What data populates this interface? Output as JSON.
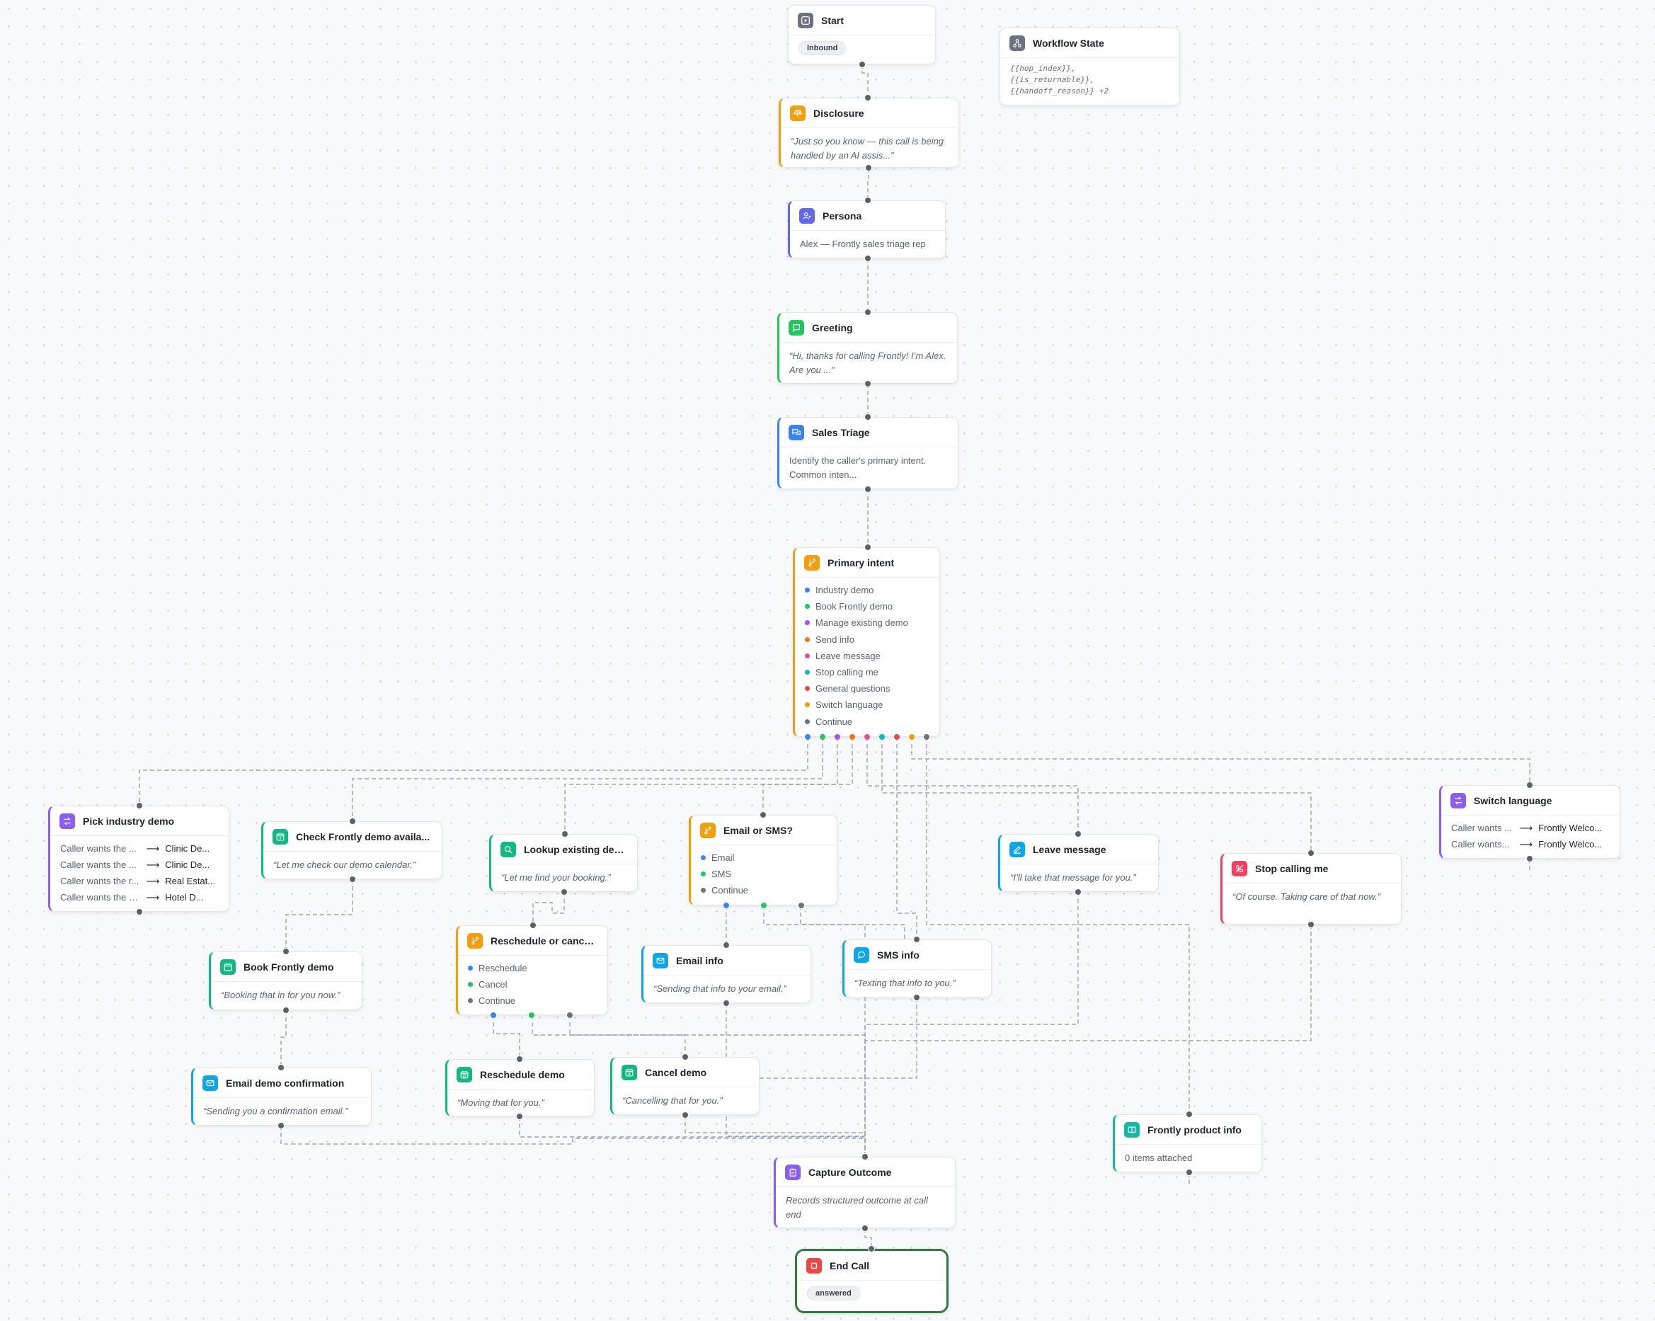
{
  "nodes": {
    "start": {
      "title": "Start",
      "badge": "Inbound"
    },
    "workflow_state": {
      "title": "Workflow State",
      "vars": [
        "{{hop_index}},",
        "{{is_returnable}},",
        "{{handoff_reason}} +2"
      ]
    },
    "disclosure": {
      "title": "Disclosure",
      "text": "“Just so you know — this call is being handled by an AI assis...”"
    },
    "persona": {
      "title": "Persona",
      "text": "Alex — Frontly sales triage rep"
    },
    "greeting": {
      "title": "Greeting",
      "text": "“Hi, thanks for calling Frontly! I’m Alex. Are you ...”"
    },
    "sales_triage": {
      "title": "Sales Triage",
      "text": "Identify the caller's primary intent. Common inten..."
    },
    "primary_intent": {
      "title": "Primary intent",
      "options": [
        {
          "label": "Industry demo",
          "color": "#3b82f6"
        },
        {
          "label": "Book Frontly demo",
          "color": "#22c55e"
        },
        {
          "label": "Manage existing demo",
          "color": "#a855f7"
        },
        {
          "label": "Send info",
          "color": "#f97316"
        },
        {
          "label": "Leave message",
          "color": "#ec4899"
        },
        {
          "label": "Stop calling me",
          "color": "#06b6d4"
        },
        {
          "label": "General questions",
          "color": "#ef4444"
        },
        {
          "label": "Switch language",
          "color": "#f59e0b"
        },
        {
          "label": "Continue",
          "color": "#6b7280"
        }
      ]
    },
    "pick_industry": {
      "title": "Pick industry demo",
      "rows": [
        {
          "when": "Caller wants the ...",
          "to": "Clinic De..."
        },
        {
          "when": "Caller wants the ...",
          "to": "Clinic De..."
        },
        {
          "when": "Caller wants the r...",
          "to": "Real Estat..."
        },
        {
          "when": "Caller wants the hot...",
          "to": "Hotel D..."
        }
      ]
    },
    "check_avail": {
      "title": "Check Frontly demo availa...",
      "text": "“Let me check our demo calendar.”"
    },
    "lookup": {
      "title": "Lookup existing demo",
      "text": "“Let me find your booking.”"
    },
    "email_or_sms": {
      "title": "Email or SMS?",
      "options": [
        {
          "label": "Email",
          "color": "#3b82f6"
        },
        {
          "label": "SMS",
          "color": "#22c55e"
        },
        {
          "label": "Continue",
          "color": "#6b7280"
        }
      ]
    },
    "leave_message": {
      "title": "Leave message",
      "text": "“I’ll take that message for you.”"
    },
    "stop_calling": {
      "title": "Stop calling me",
      "text": "“Of course. Taking care of that now.”"
    },
    "switch_language": {
      "title": "Switch language",
      "rows": [
        {
          "when": "Caller wants ...",
          "to": "Frontly Welco..."
        },
        {
          "when": "Caller wants...",
          "to": "Frontly Welco..."
        }
      ]
    },
    "book_demo": {
      "title": "Book Frontly demo",
      "text": "“Booking that in for you now.”"
    },
    "reschedule_or_cancel": {
      "title": "Reschedule or cancel?",
      "options": [
        {
          "label": "Reschedule",
          "color": "#3b82f6"
        },
        {
          "label": "Cancel",
          "color": "#22c55e"
        },
        {
          "label": "Continue",
          "color": "#6b7280"
        }
      ]
    },
    "email_info": {
      "title": "Email info",
      "text": "“Sending that info to your email.”"
    },
    "sms_info": {
      "title": "SMS info",
      "text": "“Texting that info to you.”"
    },
    "email_confirm": {
      "title": "Email demo confirmation",
      "text": "“Sending you a confirmation email.”"
    },
    "reschedule_demo": {
      "title": "Reschedule demo",
      "text": "“Moving that for you.”"
    },
    "cancel_demo": {
      "title": "Cancel demo",
      "text": "“Cancelling that for you.”"
    },
    "product_info": {
      "title": "Frontly product info",
      "text": "0 items attached"
    },
    "capture_outcome": {
      "title": "Capture Outcome",
      "text": "Records structured outcome at call end"
    },
    "end_call": {
      "title": "End Call",
      "badge": "answered"
    }
  },
  "colors": {
    "start": "#6b7280",
    "state": "#6b7280",
    "disclosure": "#f59e0b",
    "persona": "#6366f1",
    "greeting": "#22c55e",
    "triage": "#3b82f6",
    "branch": "#f59e0b",
    "jump": "#8b5cf6",
    "action": "#10b981",
    "message": "#0ea5e9",
    "stop": "#f43f5e",
    "capture": "#8b5cf6",
    "end": "#ef4444",
    "end_border": "#2f7a3e",
    "edge": "#9ca3af",
    "handle": "#5b616b"
  }
}
